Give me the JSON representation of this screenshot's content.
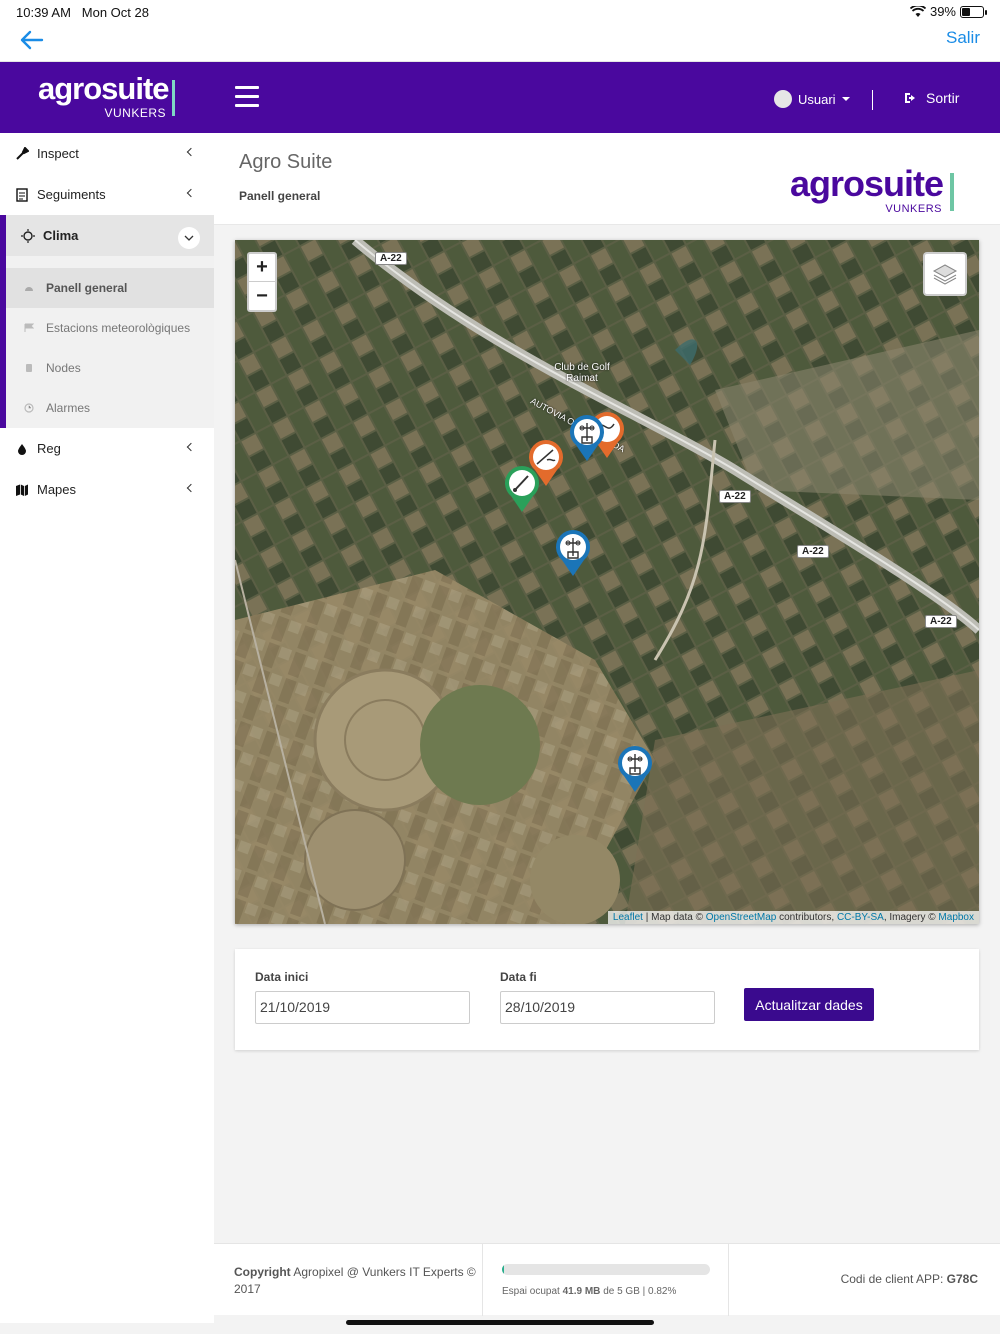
{
  "status_bar": {
    "time": "10:39 AM",
    "date": "Mon Oct 28",
    "battery": "39%",
    "battery_level": 0.39
  },
  "nav": {
    "back_icon": "arrow-left-icon",
    "salir": "Salir"
  },
  "header": {
    "logo_word": "agrosuite",
    "logo_sub": "VUNKERS",
    "user": "Usuari",
    "logout": "Sortir",
    "accent": "#4a089e"
  },
  "sidebar": {
    "items": [
      {
        "label": "Inspect",
        "icon": "eyedropper-icon"
      },
      {
        "label": "Seguiments",
        "icon": "document-icon"
      },
      {
        "label": "Clima",
        "icon": "sun-icon"
      },
      {
        "label": "Reg",
        "icon": "drop-icon"
      },
      {
        "label": "Mapes",
        "icon": "map-icon"
      }
    ],
    "clima_sub": [
      {
        "label": "Panell general",
        "icon": "dashboard-icon"
      },
      {
        "label": "Estacions meteorològiques",
        "icon": "flag-icon"
      },
      {
        "label": "Nodes",
        "icon": "node-icon"
      },
      {
        "label": "Alarmes",
        "icon": "clock-icon"
      }
    ]
  },
  "page": {
    "title": "Agro Suite",
    "subtitle": "Panell general"
  },
  "map": {
    "zoom_in": "+",
    "zoom_out": "−",
    "road_labels": [
      "A-22",
      "A-22",
      "A-22",
      "A-22"
    ],
    "place_label": "Club de Golf Raimat",
    "road_name": "AUTOVIA OSCA - LLEIDA",
    "attribution": {
      "leaflet": "Leaflet",
      "map_data": "| Map data ©",
      "osm": "OpenStreetMap",
      "contributors": "contributors,",
      "license": "CC-BY-SA",
      "imagery": ", Imagery ©",
      "mapbox": "Mapbox"
    }
  },
  "dates": {
    "start_label": "Data inici",
    "start_value": "21/10/2019",
    "end_label": "Data fi",
    "end_value": "28/10/2019",
    "update_button": "Actualitzar dades"
  },
  "footer": {
    "copyright_bold": "Copyright",
    "copyright_rest": "Agropixel @ Vunkers IT Experts © 2017",
    "storage_prefix": "Espai ocupat",
    "storage_used": "41.9 MB",
    "storage_suffix": "de 5 GB | 0.82%",
    "storage_fraction": 0.0082,
    "client_code_label": "Codi de client APP:",
    "client_code": "G78C"
  }
}
